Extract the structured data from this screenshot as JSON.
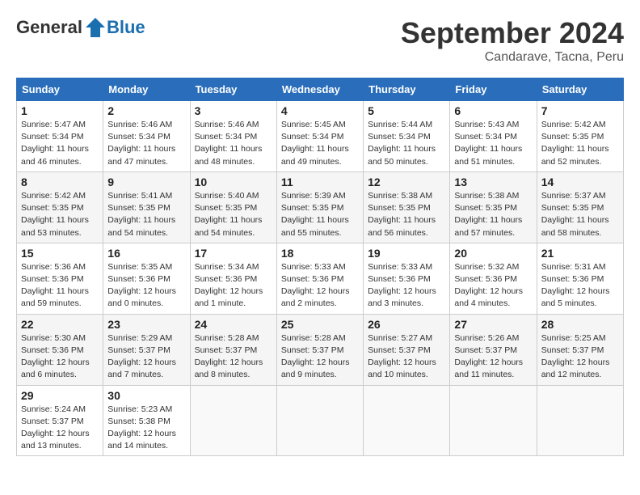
{
  "header": {
    "logo_general": "General",
    "logo_blue": "Blue",
    "month": "September 2024",
    "location": "Candarave, Tacna, Peru"
  },
  "weekdays": [
    "Sunday",
    "Monday",
    "Tuesday",
    "Wednesday",
    "Thursday",
    "Friday",
    "Saturday"
  ],
  "weeks": [
    [
      {
        "day": 1,
        "sunrise": "5:47 AM",
        "sunset": "5:34 PM",
        "daylight": "11 hours and 46 minutes."
      },
      {
        "day": 2,
        "sunrise": "5:46 AM",
        "sunset": "5:34 PM",
        "daylight": "11 hours and 47 minutes."
      },
      {
        "day": 3,
        "sunrise": "5:46 AM",
        "sunset": "5:34 PM",
        "daylight": "11 hours and 48 minutes."
      },
      {
        "day": 4,
        "sunrise": "5:45 AM",
        "sunset": "5:34 PM",
        "daylight": "11 hours and 49 minutes."
      },
      {
        "day": 5,
        "sunrise": "5:44 AM",
        "sunset": "5:34 PM",
        "daylight": "11 hours and 50 minutes."
      },
      {
        "day": 6,
        "sunrise": "5:43 AM",
        "sunset": "5:34 PM",
        "daylight": "11 hours and 51 minutes."
      },
      {
        "day": 7,
        "sunrise": "5:42 AM",
        "sunset": "5:35 PM",
        "daylight": "11 hours and 52 minutes."
      }
    ],
    [
      {
        "day": 8,
        "sunrise": "5:42 AM",
        "sunset": "5:35 PM",
        "daylight": "11 hours and 53 minutes."
      },
      {
        "day": 9,
        "sunrise": "5:41 AM",
        "sunset": "5:35 PM",
        "daylight": "11 hours and 54 minutes."
      },
      {
        "day": 10,
        "sunrise": "5:40 AM",
        "sunset": "5:35 PM",
        "daylight": "11 hours and 54 minutes."
      },
      {
        "day": 11,
        "sunrise": "5:39 AM",
        "sunset": "5:35 PM",
        "daylight": "11 hours and 55 minutes."
      },
      {
        "day": 12,
        "sunrise": "5:38 AM",
        "sunset": "5:35 PM",
        "daylight": "11 hours and 56 minutes."
      },
      {
        "day": 13,
        "sunrise": "5:38 AM",
        "sunset": "5:35 PM",
        "daylight": "11 hours and 57 minutes."
      },
      {
        "day": 14,
        "sunrise": "5:37 AM",
        "sunset": "5:35 PM",
        "daylight": "11 hours and 58 minutes."
      }
    ],
    [
      {
        "day": 15,
        "sunrise": "5:36 AM",
        "sunset": "5:36 PM",
        "daylight": "11 hours and 59 minutes."
      },
      {
        "day": 16,
        "sunrise": "5:35 AM",
        "sunset": "5:36 PM",
        "daylight": "12 hours and 0 minutes."
      },
      {
        "day": 17,
        "sunrise": "5:34 AM",
        "sunset": "5:36 PM",
        "daylight": "12 hours and 1 minute."
      },
      {
        "day": 18,
        "sunrise": "5:33 AM",
        "sunset": "5:36 PM",
        "daylight": "12 hours and 2 minutes."
      },
      {
        "day": 19,
        "sunrise": "5:33 AM",
        "sunset": "5:36 PM",
        "daylight": "12 hours and 3 minutes."
      },
      {
        "day": 20,
        "sunrise": "5:32 AM",
        "sunset": "5:36 PM",
        "daylight": "12 hours and 4 minutes."
      },
      {
        "day": 21,
        "sunrise": "5:31 AM",
        "sunset": "5:36 PM",
        "daylight": "12 hours and 5 minutes."
      }
    ],
    [
      {
        "day": 22,
        "sunrise": "5:30 AM",
        "sunset": "5:36 PM",
        "daylight": "12 hours and 6 minutes."
      },
      {
        "day": 23,
        "sunrise": "5:29 AM",
        "sunset": "5:37 PM",
        "daylight": "12 hours and 7 minutes."
      },
      {
        "day": 24,
        "sunrise": "5:28 AM",
        "sunset": "5:37 PM",
        "daylight": "12 hours and 8 minutes."
      },
      {
        "day": 25,
        "sunrise": "5:28 AM",
        "sunset": "5:37 PM",
        "daylight": "12 hours and 9 minutes."
      },
      {
        "day": 26,
        "sunrise": "5:27 AM",
        "sunset": "5:37 PM",
        "daylight": "12 hours and 10 minutes."
      },
      {
        "day": 27,
        "sunrise": "5:26 AM",
        "sunset": "5:37 PM",
        "daylight": "12 hours and 11 minutes."
      },
      {
        "day": 28,
        "sunrise": "5:25 AM",
        "sunset": "5:37 PM",
        "daylight": "12 hours and 12 minutes."
      }
    ],
    [
      {
        "day": 29,
        "sunrise": "5:24 AM",
        "sunset": "5:37 PM",
        "daylight": "12 hours and 13 minutes."
      },
      {
        "day": 30,
        "sunrise": "5:23 AM",
        "sunset": "5:38 PM",
        "daylight": "12 hours and 14 minutes."
      },
      null,
      null,
      null,
      null,
      null
    ]
  ]
}
